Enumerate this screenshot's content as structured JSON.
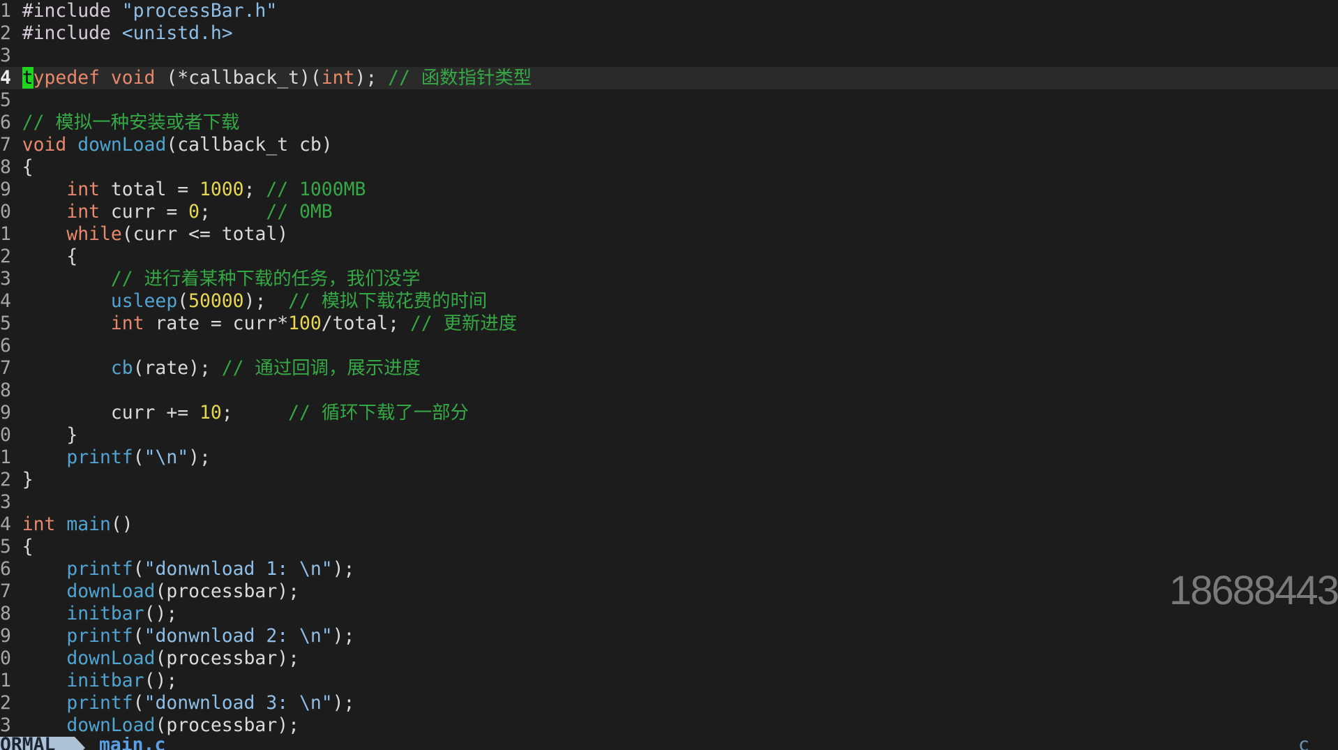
{
  "colors": {
    "background": "#1c1c1c",
    "current_line": "#2a2a2a",
    "text": "#dadada",
    "line_number": "#a6a6a6",
    "line_number_current": "#ececec",
    "keyword": "#e8896c",
    "function": "#50a5d2",
    "number": "#e6d750",
    "comment": "#35a845",
    "string": "#8fbfe6",
    "preprocessor": "#d8cbdc",
    "cursor": "#1fd41f",
    "cursor_text": "#000000",
    "mode_bg": "#aec2d6",
    "mode_text": "#1b2633",
    "status_bg": "#1c1c1c",
    "filename": "#5aa0e6",
    "filetype": "#6e94b4",
    "watermark": "#7a7a7a"
  },
  "editor": {
    "lines": [
      {
        "number": "1",
        "tokens": [
          {
            "t": "#include",
            "c": "#d8cbdc"
          },
          {
            "t": " "
          },
          {
            "t": "\"processBar.h\"",
            "c": "#8fbfe6"
          }
        ]
      },
      {
        "number": "2",
        "tokens": [
          {
            "t": "#include",
            "c": "#d8cbdc"
          },
          {
            "t": " "
          },
          {
            "t": "<unistd.h>",
            "c": "#8fbfe6"
          }
        ]
      },
      {
        "number": "3",
        "tokens": []
      },
      {
        "number": "4",
        "current": true,
        "tokens": [
          {
            "t": "t",
            "c": "#e8896c",
            "cursor": true
          },
          {
            "t": "ypedef",
            "c": "#e8896c"
          },
          {
            "t": " "
          },
          {
            "t": "void",
            "c": "#e8896c"
          },
          {
            "t": " (*callback_t)("
          },
          {
            "t": "int",
            "c": "#e8896c"
          },
          {
            "t": "); "
          },
          {
            "t": "// 函数指针类型",
            "c": "#35a845"
          }
        ]
      },
      {
        "number": "5",
        "tokens": []
      },
      {
        "number": "6",
        "tokens": [
          {
            "t": "// 模拟一种安装或者下载",
            "c": "#35a845"
          }
        ]
      },
      {
        "number": "7",
        "tokens": [
          {
            "t": "void",
            "c": "#e8896c"
          },
          {
            "t": " "
          },
          {
            "t": "downLoad",
            "c": "#50a5d2"
          },
          {
            "t": "(callback_t cb)"
          }
        ]
      },
      {
        "number": "8",
        "tokens": [
          {
            "t": "{"
          }
        ]
      },
      {
        "number": "9",
        "tokens": [
          {
            "t": "    "
          },
          {
            "t": "int",
            "c": "#e8896c"
          },
          {
            "t": " total = "
          },
          {
            "t": "1000",
            "c": "#e6d750"
          },
          {
            "t": "; "
          },
          {
            "t": "// 1000MB",
            "c": "#35a845"
          }
        ]
      },
      {
        "number": "0",
        "tokens": [
          {
            "t": "    "
          },
          {
            "t": "int",
            "c": "#e8896c"
          },
          {
            "t": " curr = "
          },
          {
            "t": "0",
            "c": "#e6d750"
          },
          {
            "t": ";     "
          },
          {
            "t": "// 0MB",
            "c": "#35a845"
          }
        ]
      },
      {
        "number": "1",
        "tokens": [
          {
            "t": "    "
          },
          {
            "t": "while",
            "c": "#e8896c"
          },
          {
            "t": "(curr <= total)"
          }
        ]
      },
      {
        "number": "2",
        "tokens": [
          {
            "t": "    {"
          }
        ]
      },
      {
        "number": "3",
        "tokens": [
          {
            "t": "        "
          },
          {
            "t": "// 进行着某种下载的任务，我们没学",
            "c": "#35a845"
          }
        ]
      },
      {
        "number": "4",
        "tokens": [
          {
            "t": "        "
          },
          {
            "t": "usleep",
            "c": "#50a5d2"
          },
          {
            "t": "("
          },
          {
            "t": "50000",
            "c": "#e6d750"
          },
          {
            "t": ");  "
          },
          {
            "t": "// 模拟下载花费的时间",
            "c": "#35a845"
          }
        ]
      },
      {
        "number": "5",
        "tokens": [
          {
            "t": "        "
          },
          {
            "t": "int",
            "c": "#e8896c"
          },
          {
            "t": " rate = curr*"
          },
          {
            "t": "100",
            "c": "#e6d750"
          },
          {
            "t": "/total; "
          },
          {
            "t": "// 更新进度",
            "c": "#35a845"
          }
        ]
      },
      {
        "number": "6",
        "tokens": []
      },
      {
        "number": "7",
        "tokens": [
          {
            "t": "        "
          },
          {
            "t": "cb",
            "c": "#50a5d2"
          },
          {
            "t": "(rate); "
          },
          {
            "t": "// 通过回调，展示进度",
            "c": "#35a845"
          }
        ]
      },
      {
        "number": "8",
        "tokens": []
      },
      {
        "number": "9",
        "tokens": [
          {
            "t": "        curr += "
          },
          {
            "t": "10",
            "c": "#e6d750"
          },
          {
            "t": ";     "
          },
          {
            "t": "// 循环下载了一部分",
            "c": "#35a845"
          }
        ]
      },
      {
        "number": "0",
        "tokens": [
          {
            "t": "    }"
          }
        ]
      },
      {
        "number": "1",
        "tokens": [
          {
            "t": "    "
          },
          {
            "t": "printf",
            "c": "#50a5d2"
          },
          {
            "t": "("
          },
          {
            "t": "\"\\n\"",
            "c": "#8fbfe6"
          },
          {
            "t": ");"
          }
        ]
      },
      {
        "number": "2",
        "tokens": [
          {
            "t": "}"
          }
        ]
      },
      {
        "number": "3",
        "tokens": []
      },
      {
        "number": "4",
        "tokens": [
          {
            "t": "int",
            "c": "#e8896c"
          },
          {
            "t": " "
          },
          {
            "t": "main",
            "c": "#50a5d2"
          },
          {
            "t": "()"
          }
        ]
      },
      {
        "number": "5",
        "tokens": [
          {
            "t": "{"
          }
        ]
      },
      {
        "number": "6",
        "tokens": [
          {
            "t": "    "
          },
          {
            "t": "printf",
            "c": "#50a5d2"
          },
          {
            "t": "("
          },
          {
            "t": "\"donwnload 1: \\n\"",
            "c": "#8fbfe6"
          },
          {
            "t": ");"
          }
        ]
      },
      {
        "number": "7",
        "tokens": [
          {
            "t": "    "
          },
          {
            "t": "downLoad",
            "c": "#50a5d2"
          },
          {
            "t": "(processbar);"
          }
        ]
      },
      {
        "number": "8",
        "tokens": [
          {
            "t": "    "
          },
          {
            "t": "initbar",
            "c": "#50a5d2"
          },
          {
            "t": "();"
          }
        ]
      },
      {
        "number": "9",
        "tokens": [
          {
            "t": "    "
          },
          {
            "t": "printf",
            "c": "#50a5d2"
          },
          {
            "t": "("
          },
          {
            "t": "\"donwnload 2: \\n\"",
            "c": "#8fbfe6"
          },
          {
            "t": ");"
          }
        ]
      },
      {
        "number": "0",
        "tokens": [
          {
            "t": "    "
          },
          {
            "t": "downLoad",
            "c": "#50a5d2"
          },
          {
            "t": "(processbar);"
          }
        ]
      },
      {
        "number": "1",
        "tokens": [
          {
            "t": "    "
          },
          {
            "t": "initbar",
            "c": "#50a5d2"
          },
          {
            "t": "();"
          }
        ]
      },
      {
        "number": "2",
        "tokens": [
          {
            "t": "    "
          },
          {
            "t": "printf",
            "c": "#50a5d2"
          },
          {
            "t": "("
          },
          {
            "t": "\"donwnload 3: \\n\"",
            "c": "#8fbfe6"
          },
          {
            "t": ");"
          }
        ]
      },
      {
        "number": "3",
        "tokens": [
          {
            "t": "    "
          },
          {
            "t": "downLoad",
            "c": "#50a5d2"
          },
          {
            "t": "(processbar);"
          }
        ]
      }
    ],
    "statusline": {
      "mode": "ORMAL",
      "filename": "main.c",
      "filetype": "c"
    }
  },
  "watermark": "18688443"
}
